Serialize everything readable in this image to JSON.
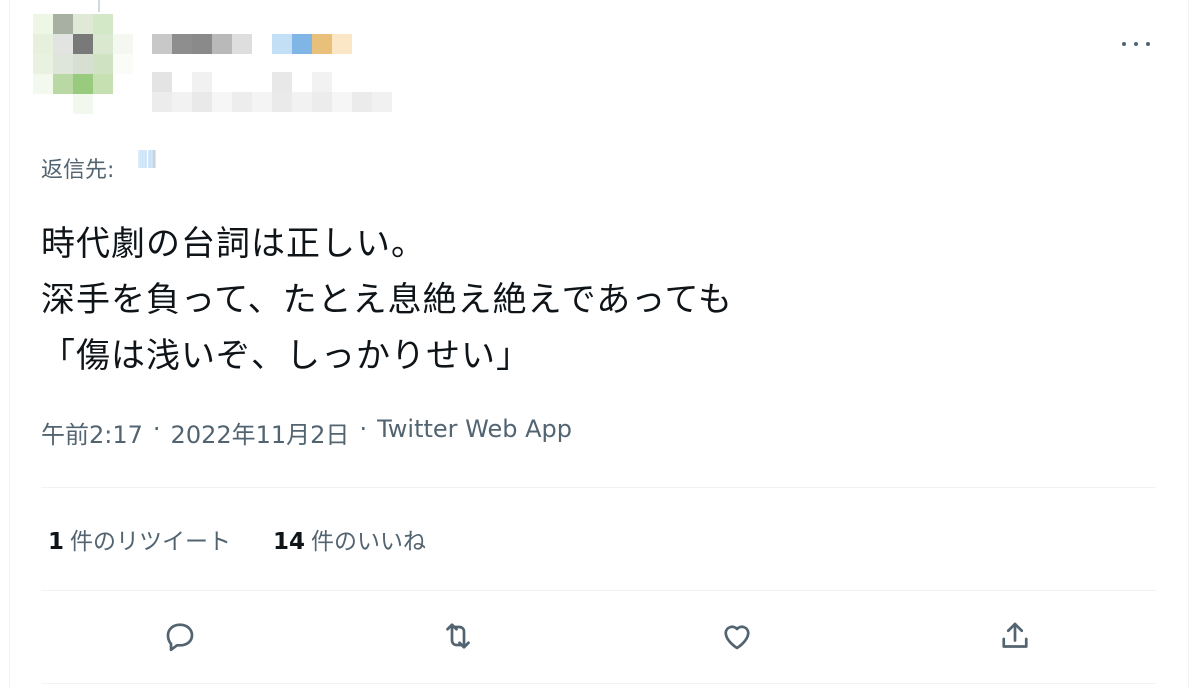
{
  "tweet": {
    "reply_label": "返信先:",
    "text": "時代劇の台詞は正しい。\n深手を負って、たとえ息絶え絶えであっても\n「傷は浅いぞ、しっかりせい」",
    "time": "午前2:17",
    "separator": "·",
    "date": "2022年11月2日",
    "source": "Twitter Web App"
  },
  "stats": {
    "retweets": {
      "count": "1",
      "label": "件のリツイート"
    },
    "likes": {
      "count": "14",
      "label": "件のいいね"
    }
  },
  "actions": [
    {
      "icon": "reply-icon"
    },
    {
      "icon": "retweet-icon"
    },
    {
      "icon": "like-icon"
    },
    {
      "icon": "share-icon"
    }
  ],
  "colors": {
    "text": "#0f1419",
    "secondary": "#536471",
    "divider": "#eff3f4"
  }
}
